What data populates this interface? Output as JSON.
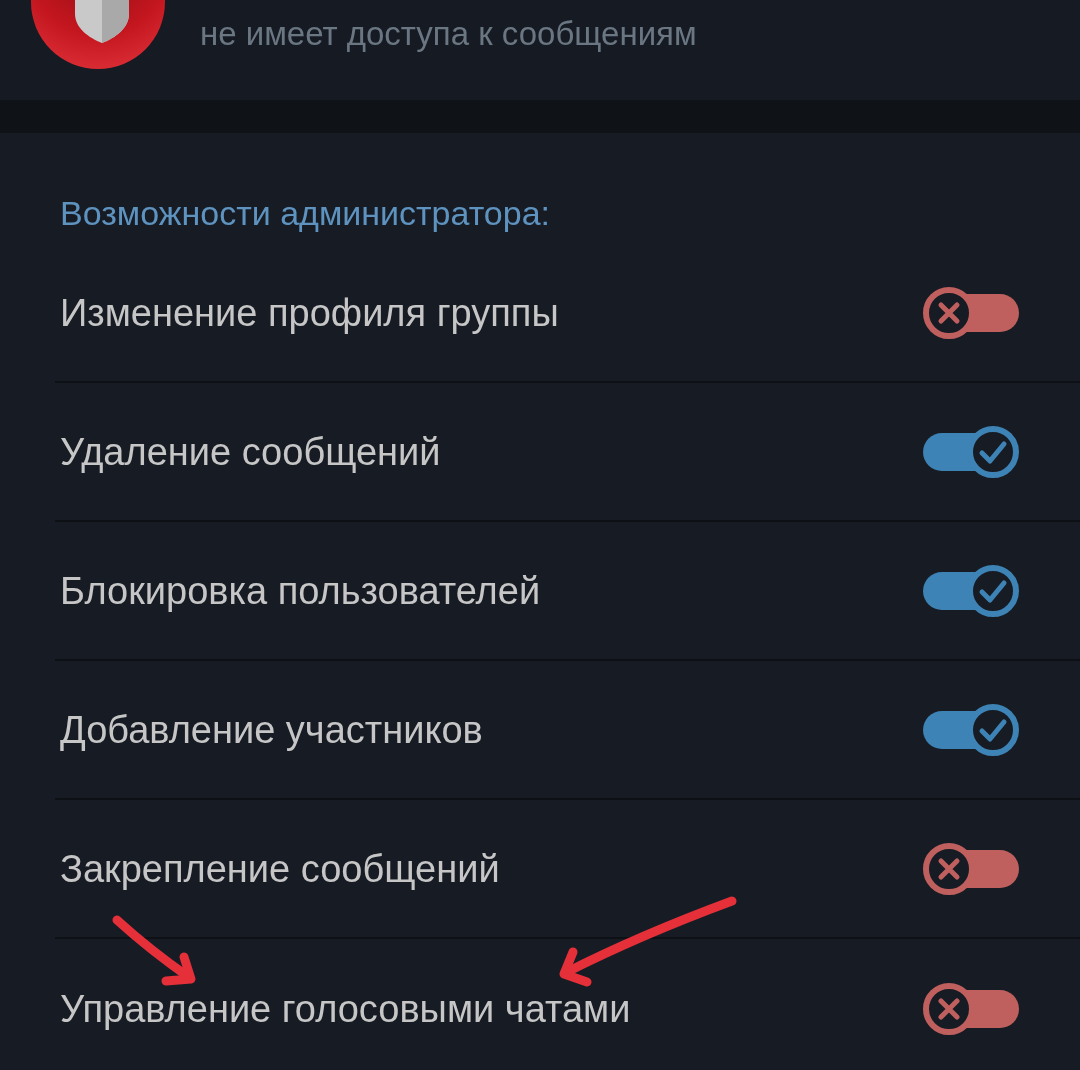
{
  "header": {
    "subtitle": "не имеет доступа к сообщениям"
  },
  "section": {
    "title": "Возможности администратора:",
    "permissions": [
      {
        "label": "Изменение профиля группы",
        "on": false
      },
      {
        "label": "Удаление сообщений",
        "on": true
      },
      {
        "label": "Блокировка пользователей",
        "on": true
      },
      {
        "label": "Добавление участников",
        "on": true
      },
      {
        "label": "Закрепление сообщений",
        "on": false
      },
      {
        "label": "Управление голосовыми чатами",
        "on": false
      }
    ]
  }
}
